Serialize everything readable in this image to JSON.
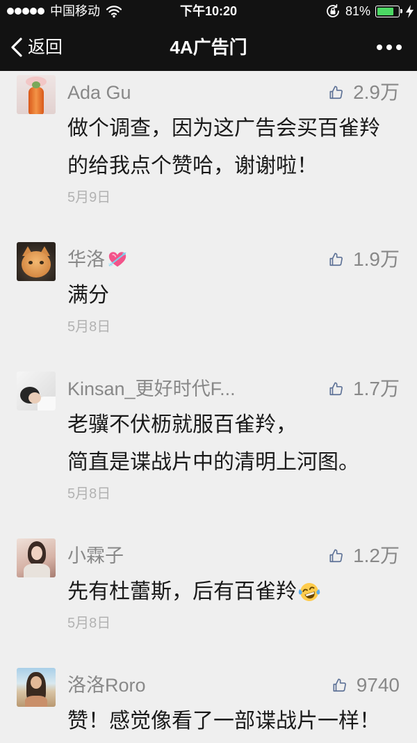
{
  "status_bar": {
    "signal_icon": "signal-dots-icon",
    "carrier": "中国移动",
    "wifi_icon": "wifi-icon",
    "time": "下午10:20",
    "orientation_lock_icon": "orientation-lock-icon",
    "battery_text": "81%",
    "battery_level": 0.81,
    "battery_icon": "battery-icon",
    "charging_icon": "charging-bolt-icon"
  },
  "nav_bar": {
    "back_icon": "chevron-left-icon",
    "back_label": "返回",
    "title": "4A广告门",
    "more_icon": "more-dots-icon"
  },
  "colors": {
    "top_bar_background": "#121212",
    "page_background": "#efefef",
    "name_text": "#888888",
    "comment_text": "#1a1a1a",
    "date_text": "#b2b2b2",
    "like_icon": "#5d7196",
    "battery_fill": "#4cd964"
  },
  "like_icon": "thumbs-up-icon",
  "comments": [
    {
      "name": "Ada Gu",
      "likes": "2.9万",
      "lines": [
        "做个调查，因为这广告会买百雀羚",
        "的给我点个赞哈，谢谢啦！"
      ],
      "date": "5月9日"
    },
    {
      "name": "华洛",
      "name_emoji": "heart-with-arrow-emoji",
      "likes": "1.9万",
      "lines": [
        "满分"
      ],
      "date": "5月8日"
    },
    {
      "name": "Kinsan_更好时代F...",
      "likes": "1.7万",
      "lines": [
        "老骥不伏枥就服百雀羚，",
        "简直是谍战片中的清明上河图。"
      ],
      "date": "5月8日"
    },
    {
      "name": "小霖子",
      "likes": "1.2万",
      "lines": [
        "先有杜蕾斯，后有百雀羚"
      ],
      "line_emoji": "face-with-tears-of-joy-emoji",
      "date": "5月8日"
    },
    {
      "name": "洛洛Roro",
      "likes": "9740",
      "lines": [
        "赞！感觉像看了一部谍战片一样！"
      ]
    }
  ]
}
